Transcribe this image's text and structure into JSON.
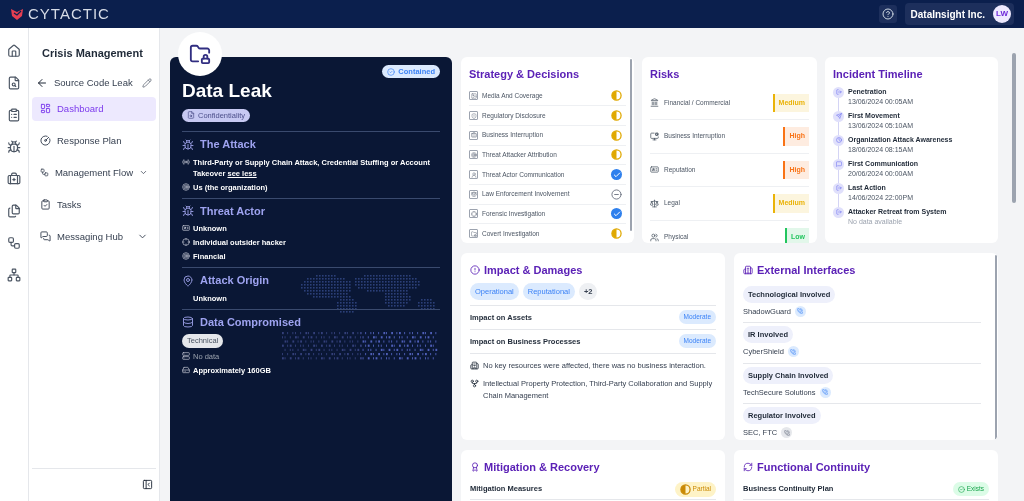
{
  "header": {
    "brand": "CYTACTIC",
    "organization": "DataInsight Inc.",
    "avatar": "LW"
  },
  "sidebar": {
    "title": "Crisis Management",
    "incident": "Source Code Leak",
    "items": [
      {
        "label": "Dashboard",
        "selected": true,
        "kind": "link"
      },
      {
        "label": "Response Plan",
        "selected": false,
        "kind": "link"
      },
      {
        "label": "Management Flow",
        "selected": false,
        "kind": "group",
        "expanded": false
      },
      {
        "label": "Tasks",
        "selected": false,
        "kind": "link"
      },
      {
        "label": "Messaging Hub",
        "selected": false,
        "kind": "group",
        "expanded": false
      }
    ]
  },
  "incident_card": {
    "status": "Contained",
    "title": "Data Leak",
    "tag": "Confidentiality",
    "sections": [
      {
        "kind": "attack",
        "title": "The Attack",
        "items": [
          {
            "text": "Third-Party or Supply Chain Attack, Credential Stuffing or Account Takeover",
            "link": "see less",
            "muted": false
          },
          {
            "text": "Us (the organization)",
            "muted": false
          }
        ]
      },
      {
        "kind": "actor",
        "title": "Threat Actor",
        "items": [
          {
            "text": "Unknown",
            "muted": false
          },
          {
            "text": "Individual outsider hacker",
            "muted": false
          },
          {
            "text": "Financial",
            "muted": false
          }
        ]
      },
      {
        "kind": "origin",
        "title": "Attack Origin",
        "items": [
          {
            "text": "Unknown",
            "muted": false
          }
        ]
      },
      {
        "kind": "data",
        "title": "Data Compromised",
        "tag": "Technical",
        "items": [
          {
            "text": "No data",
            "muted": true
          },
          {
            "text": "Approximately 160GB",
            "muted": false
          }
        ]
      }
    ]
  },
  "strategy": {
    "title": "Strategy & Decisions",
    "items": [
      {
        "label": "Media And Coverage",
        "kind": "partial"
      },
      {
        "label": "Regulatory Disclosure",
        "kind": "partial"
      },
      {
        "label": "Business Interruption",
        "kind": "partial"
      },
      {
        "label": "Threat Attacker Attribution",
        "kind": "partial"
      },
      {
        "label": "Threat Actor Communication",
        "kind": "done"
      },
      {
        "label": "Law Enforcement Involvement",
        "kind": "none"
      },
      {
        "label": "Forensic Investigation",
        "kind": "done"
      },
      {
        "label": "Covert Investigation",
        "kind": "partial"
      }
    ]
  },
  "risks": {
    "title": "Risks",
    "items": [
      {
        "label": "Financial / Commercial",
        "level": "Medium",
        "color": "#eab308"
      },
      {
        "label": "Business Interruption",
        "level": "High",
        "color": "#f97316"
      },
      {
        "label": "Reputation",
        "level": "High",
        "color": "#f97316"
      },
      {
        "label": "Legal",
        "level": "Medium",
        "color": "#eab308"
      },
      {
        "label": "Physical",
        "level": "Low",
        "color": "#22c55e"
      }
    ]
  },
  "timeline": {
    "title": "Incident Timeline",
    "events": [
      {
        "title": "Penetration",
        "time": "13/06/2024 00:05AM",
        "muted": false
      },
      {
        "title": "First Movement",
        "time": "13/06/2024 05:10AM",
        "muted": false
      },
      {
        "title": "Organization Attack Awareness",
        "time": "18/06/2024 08:15AM",
        "muted": false
      },
      {
        "title": "First Communication",
        "time": "20/06/2024 00:00AM",
        "muted": false
      },
      {
        "title": "Last Action",
        "time": "14/06/2024 22:00PM",
        "muted": false
      },
      {
        "title": "Attacker Retreat from System",
        "time": "No data available",
        "muted": true
      }
    ]
  },
  "impact": {
    "title": "Impact & Damages",
    "tags": [
      {
        "label": "Operational",
        "kind": "category"
      },
      {
        "label": "Reputational",
        "kind": "category"
      },
      {
        "label": "+2",
        "kind": "more"
      }
    ],
    "rows": [
      {
        "label": "Impact on Assets",
        "rating": "Moderate"
      },
      {
        "label": "Impact on Business Processes",
        "rating": "Moderate"
      }
    ],
    "notes": [
      "No key resources were affected, there was no business interaction.",
      "Intellectual Property Protection, Third-Party Collaboration and Supply Chain Management"
    ]
  },
  "external": {
    "title": "External Interfaces",
    "groups": [
      {
        "label": "Technological Involved",
        "value": "ShadowGuard",
        "contact_available": true
      },
      {
        "label": "IR Involved",
        "value": "CyberShield",
        "contact_available": true
      },
      {
        "label": "Supply Chain Involved",
        "value": "TechSecure Solutions",
        "contact_available": true
      },
      {
        "label": "Regulator Involved",
        "value": "SEC, FTC",
        "contact_available": false
      }
    ]
  },
  "mitigation": {
    "title": "Mitigation & Recovery",
    "rows": [
      {
        "label": "Mitigation Measures",
        "status": "Partial",
        "kind": "partial"
      }
    ]
  },
  "continuity": {
    "title": "Functional Continuity",
    "rows": [
      {
        "label": "Business Continuity Plan",
        "status": "Exists",
        "kind": "exists"
      }
    ]
  }
}
